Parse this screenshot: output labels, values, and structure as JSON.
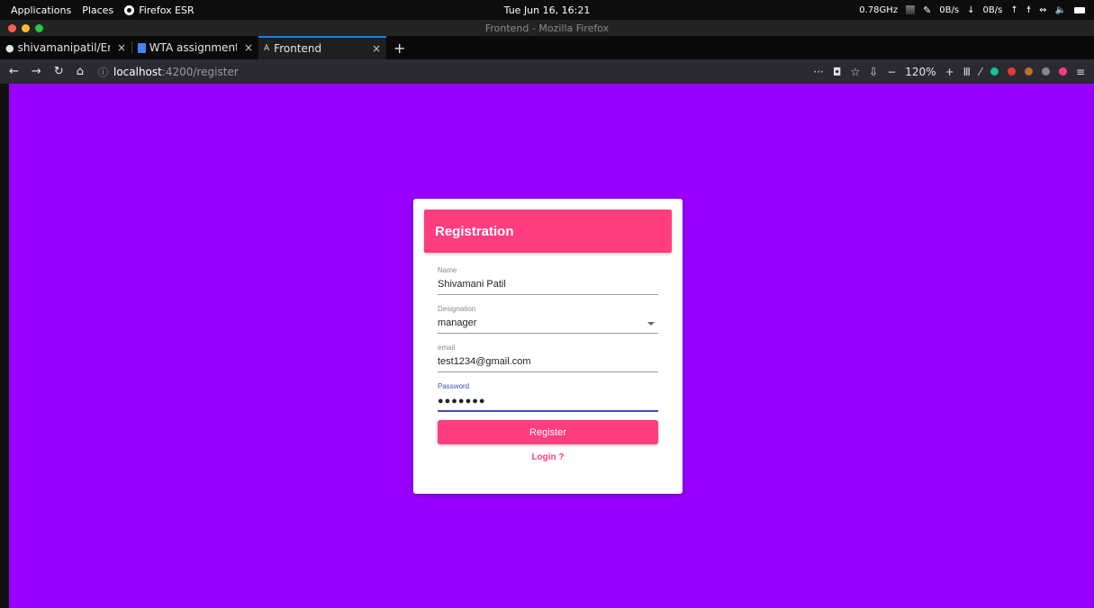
{
  "system_bar": {
    "applications": "Applications",
    "places": "Places",
    "app_name": "Firefox ESR",
    "clock": "Tue Jun 16, 16:21",
    "cpu": "0.78GHz",
    "net_down": "0B/s",
    "net_up": "0B/s"
  },
  "window": {
    "title": "Frontend - Mozilla Firefox"
  },
  "tabs": [
    {
      "label": "shivamanipatil/Em",
      "active": false
    },
    {
      "label": "WTA assignment",
      "active": false
    },
    {
      "label": "Frontend",
      "active": true
    }
  ],
  "navbar": {
    "url_host": "localhost",
    "url_path": ":4200/register",
    "zoom": "120%"
  },
  "page": {
    "background": "#9900ff",
    "card_title": "Registration",
    "fields": {
      "name_label": "Name",
      "name_value": "Shivamani Patil",
      "designation_label": "Designation",
      "designation_value": "manager",
      "email_label": "email",
      "email_value": "test1234@gmail.com",
      "password_label": "Password",
      "password_value": "●●●●●●●"
    },
    "register_label": "Register",
    "login_label": "Login ?",
    "accent": "#ff3d7f",
    "focus": "#3f51b5"
  }
}
